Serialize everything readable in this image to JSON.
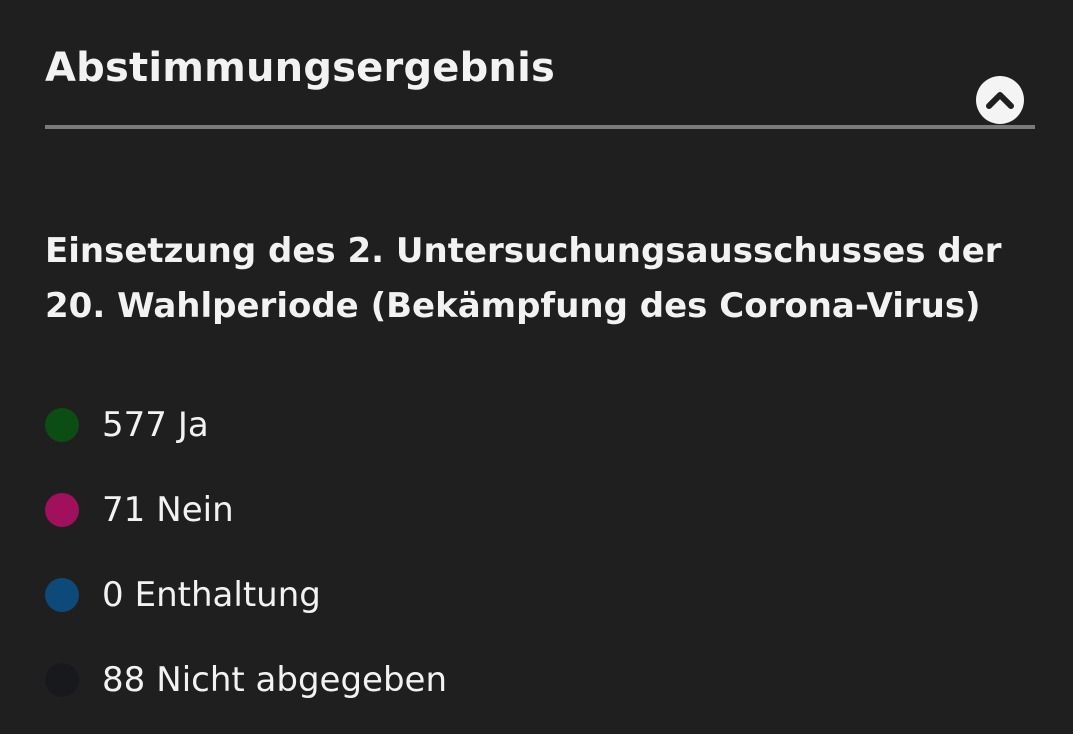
{
  "header": {
    "title": "Abstimmungsergebnis",
    "toggle_icon": "chevron-up-icon"
  },
  "vote": {
    "title": "Einsetzung des 2. Untersuchungsausschusses der 20. Wahlperiode (Bekämpfung des Corona-Virus)"
  },
  "results": [
    {
      "count": "577",
      "label": "Ja",
      "color": "#0b4d12"
    },
    {
      "count": "71",
      "label": "Nein",
      "color": "#a0105d"
    },
    {
      "count": "0",
      "label": "Enthaltung",
      "color": "#0d4a7a"
    },
    {
      "count": "88",
      "label": "Nicht abgegeben",
      "color": "#17191c"
    }
  ]
}
